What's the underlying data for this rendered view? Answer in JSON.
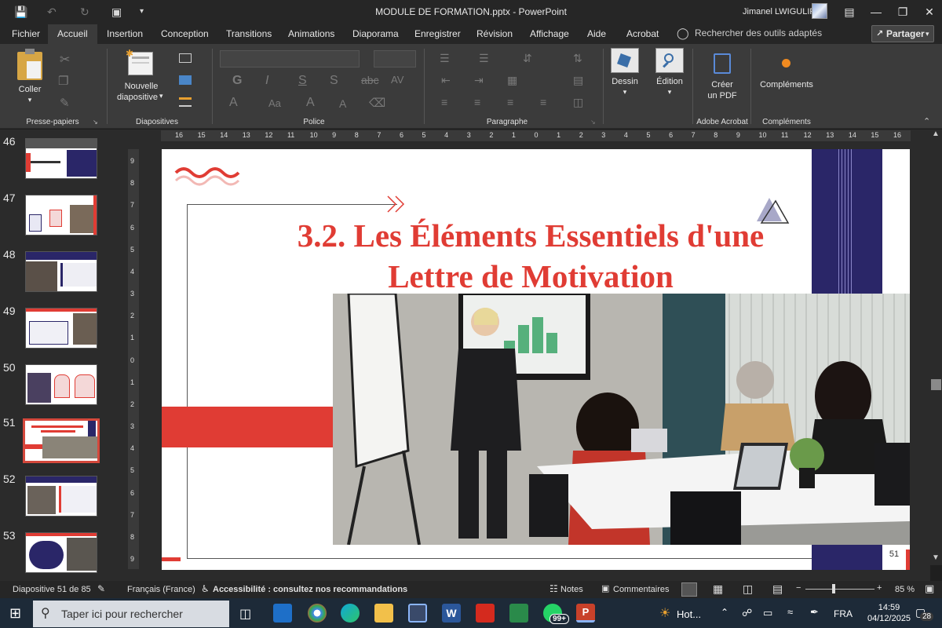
{
  "window": {
    "title": "MODULE DE FORMATION.pptx  -  PowerPoint",
    "user": "Jimanel LWIGULIRA"
  },
  "menu": {
    "tabs": [
      "Fichier",
      "Accueil",
      "Insertion",
      "Conception",
      "Transitions",
      "Animations",
      "Diaporama",
      "Enregistrer",
      "Révision",
      "Affichage",
      "Aide",
      "Acrobat"
    ],
    "active_tab": "Accueil",
    "search_placeholder": "Rechercher des outils adaptés",
    "share_label": "Partager"
  },
  "ribbon": {
    "clipboard": {
      "paste_label": "Coller",
      "group_label": "Presse-papiers"
    },
    "slides": {
      "new_slide_line1": "Nouvelle",
      "new_slide_line2": "diapositive",
      "group_label": "Diapositives"
    },
    "font": {
      "group_label": "Police"
    },
    "paragraph": {
      "group_label": "Paragraphe"
    },
    "drawing": {
      "label": "Dessin"
    },
    "editing": {
      "label": "Édition"
    },
    "acrobat": {
      "create_line1": "Créer",
      "create_line2": "un PDF",
      "group_label": "Adobe Acrobat"
    },
    "addins": {
      "label": "Compléments",
      "group_label": "Compléments"
    }
  },
  "thumbnails": [
    {
      "number": "46",
      "selected": false
    },
    {
      "number": "47",
      "selected": false
    },
    {
      "number": "48",
      "selected": false
    },
    {
      "number": "49",
      "selected": false
    },
    {
      "number": "50",
      "selected": false
    },
    {
      "number": "51",
      "selected": true
    },
    {
      "number": "52",
      "selected": false
    },
    {
      "number": "53",
      "selected": false
    }
  ],
  "rulers": {
    "horizontal": [
      "16",
      "15",
      "14",
      "13",
      "12",
      "11",
      "10",
      "9",
      "8",
      "7",
      "6",
      "5",
      "4",
      "3",
      "2",
      "1",
      "0",
      "1",
      "2",
      "3",
      "4",
      "5",
      "6",
      "7",
      "8",
      "9",
      "10",
      "11",
      "12",
      "13",
      "14",
      "15",
      "16"
    ],
    "vertical": [
      "9",
      "8",
      "7",
      "6",
      "5",
      "4",
      "3",
      "2",
      "1",
      "0",
      "1",
      "2",
      "3",
      "4",
      "5",
      "6",
      "7",
      "8",
      "9"
    ]
  },
  "slide": {
    "title_line1": "3.2. Les Éléments Essentiels d'une",
    "title_line2": "Lettre de Motivation",
    "number": "51",
    "accent_color": "#e03c34",
    "navy_color": "#2a2668"
  },
  "statusbar": {
    "slide_info": "Diapositive 51 de 85",
    "language": "Français (France)",
    "accessibility": "Accessibilité : consultez nos recommandations",
    "notes": "Notes",
    "comments": "Commentaires",
    "zoom": "85 %"
  },
  "taskbar": {
    "search_placeholder": "Taper ici pour rechercher",
    "weather": "Hot...",
    "lang": "FRA",
    "time": "14:59",
    "date": "04/12/2025",
    "badge_count": "99+",
    "notif_count": "28"
  }
}
